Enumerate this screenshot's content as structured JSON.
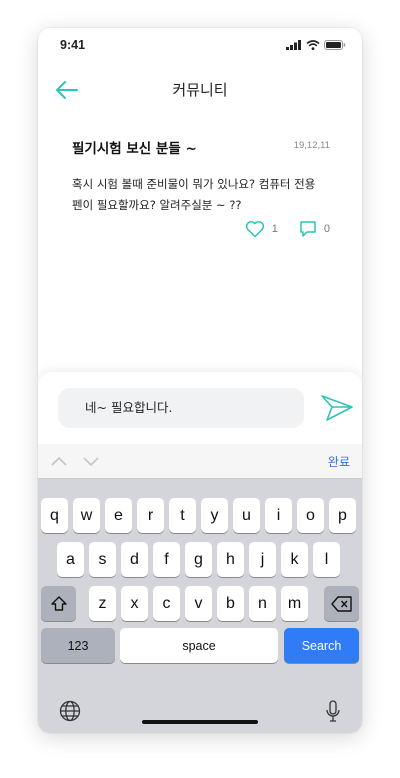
{
  "status_bar": {
    "time": "9:41"
  },
  "header": {
    "title": "커뮤니티",
    "back_icon": "arrow-left-icon"
  },
  "post": {
    "title": "필기시험 보신 분들 ~",
    "date": "19,12,11",
    "body_line1": "혹시 시험 볼때 준비물이 뭐가 있나요? 컴퓨터 전용",
    "body_line2": "펜이 필요할까요? 알려주실분 ~ ??",
    "likes": "1",
    "comments": "0"
  },
  "composer": {
    "input_value": "네~ 필요합니다."
  },
  "keyboard": {
    "done_label": "완료",
    "row1": [
      "q",
      "w",
      "e",
      "r",
      "t",
      "y",
      "u",
      "i",
      "o",
      "p"
    ],
    "row2": [
      "a",
      "s",
      "d",
      "f",
      "g",
      "h",
      "j",
      "k",
      "l"
    ],
    "row3": [
      "z",
      "x",
      "c",
      "v",
      "b",
      "n",
      "m"
    ],
    "numbers_label": "123",
    "space_label": "space",
    "search_label": "Search"
  },
  "colors": {
    "accent": "#2ec4b6",
    "search_key": "#2f7cf6",
    "done_link": "#2f6fde"
  }
}
